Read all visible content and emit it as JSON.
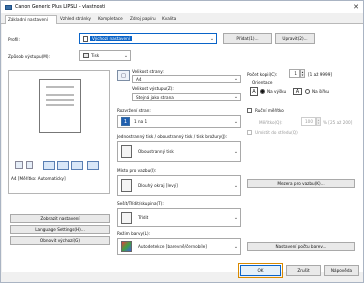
{
  "window": {
    "title": "Canon Generic Plus LIPSLI - vlastnosti",
    "close_glyph": "✕"
  },
  "tabs": [
    "Základní nastavení",
    "Vzhled stránky",
    "Kompletace",
    "Zdroj papíru",
    "Kvalita"
  ],
  "profile": {
    "label": "Profil:",
    "value": "Výchozí nastavení",
    "add_button": "Přidat(1)...",
    "edit_button": "Upravit(2)..."
  },
  "output": {
    "label": "Způsob výstupu(M):",
    "value": "Tisk"
  },
  "preview": {
    "caption": "A4 [Měřítko: Automaticky]"
  },
  "left_buttons": {
    "show_settings": "Zobrazit nastavení",
    "language": "Language Settings(H)...",
    "restore": "Obnovit výchozí(G)"
  },
  "page_size": {
    "label": "Velikost strany:",
    "value": "A4"
  },
  "output_size": {
    "label": "Velikost výstupu(Z):",
    "value": "Stejná jako strana"
  },
  "layout": {
    "label": "Rozvržení stran:",
    "value": "1 na 1"
  },
  "duplex": {
    "label": "Jednostranný tisk / oboustranný tisk / tisk brožury(J):",
    "value": "Oboustranný tisk"
  },
  "binding": {
    "label": "Místo pro vazbu(I):",
    "value": "Dlouhý okraj [levý]",
    "button": "Mezera pro vazbu(K)..."
  },
  "finishing": {
    "label": "Sešít/Třídit/skupina(T):",
    "value": "Třídit"
  },
  "color": {
    "label": "Režim barvy(L):",
    "value": "Autodetekce [barevně/černobíle]",
    "button": "Nastavení počtu barev..."
  },
  "copies": {
    "label": "Počet kopií(C):",
    "value": "1",
    "range": "[1 až 9999]"
  },
  "orientation": {
    "label": "Orientace",
    "portrait": "Na výšku",
    "landscape": "Na šířku",
    "selected": "portrait"
  },
  "scaling": {
    "label": "Ruční měřítko",
    "field_label": "Měřítko(Q):",
    "value": "100",
    "unit": "% [25 až 200]",
    "center_label": "Umístit do středu(Q)"
  },
  "footer": {
    "ok": "OK",
    "cancel": "Zrušit",
    "help": "Nápověda"
  }
}
